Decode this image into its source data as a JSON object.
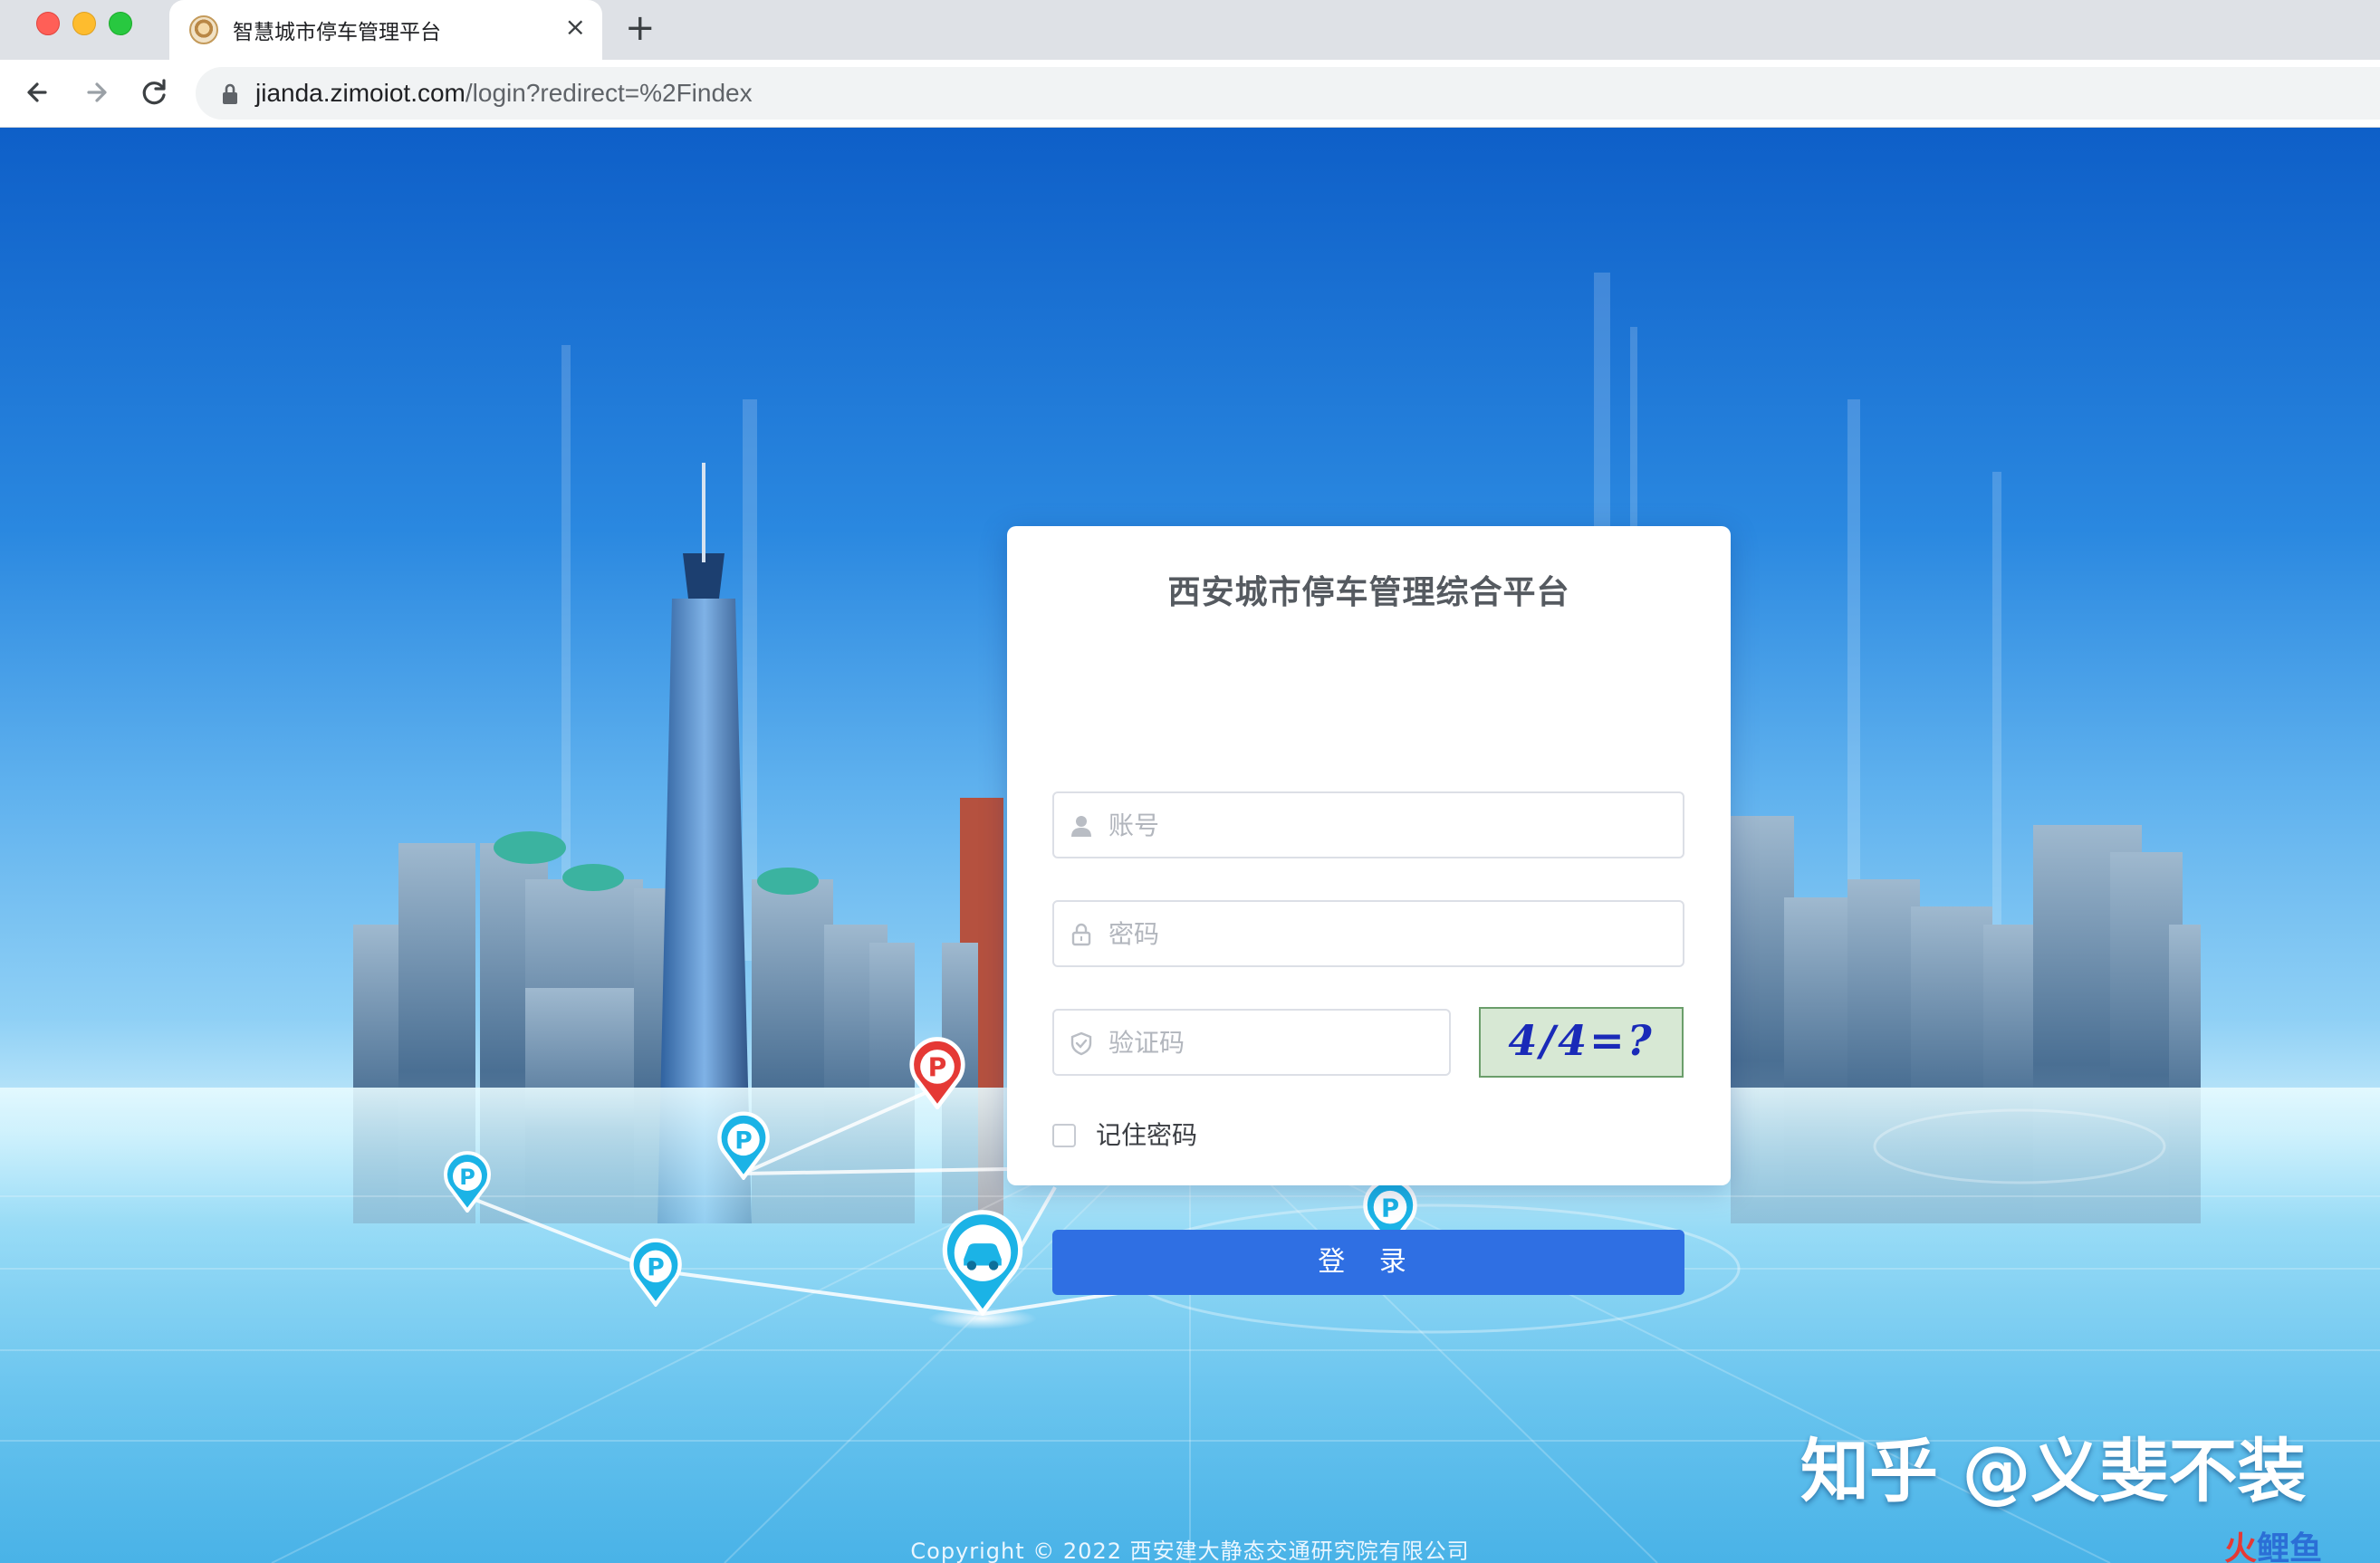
{
  "browser": {
    "tab_title": "智慧城市停车管理平台",
    "tab_close": "×",
    "new_tab": "+",
    "url_host": "jianda.zimoiot.com",
    "url_path": "/login?redirect=%2Findex"
  },
  "login": {
    "title": "西安城市停车管理综合平台",
    "username_placeholder": "账号",
    "password_placeholder": "密码",
    "captcha_placeholder": "验证码",
    "captcha_text": "4/4=?",
    "remember_label": "记住密码",
    "remember_checked": false,
    "submit_label": "登 录"
  },
  "map_markers": {
    "parking_label": "P"
  },
  "footer": {
    "copyright": "Copyright © 2022 西安建大静态交通研究院有限公司"
  },
  "watermark": {
    "text": "知乎 @义斐不装",
    "logo_part1": "火",
    "logo_part2": "鲤鱼"
  },
  "colors": {
    "primary_button": "#2f6fe3",
    "marker_red": "#e53935",
    "marker_cyan": "#1bb3e6"
  }
}
